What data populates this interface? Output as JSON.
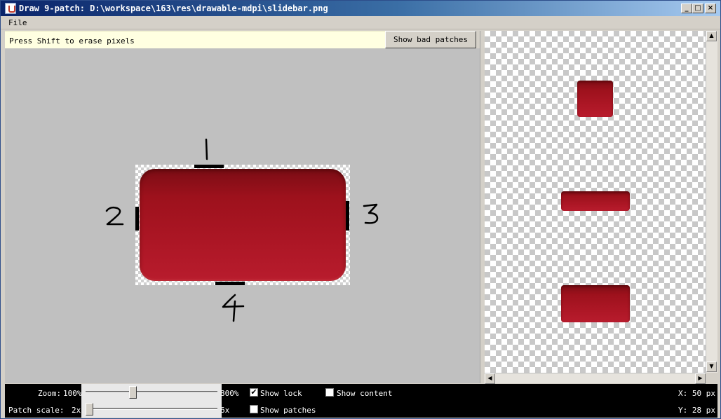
{
  "window": {
    "title": "Draw 9-patch: D:\\workspace\\163\\res\\drawable-mdpi\\slidebar.png",
    "buttons": {
      "minimize": "_",
      "maximize": "□",
      "close": "×"
    }
  },
  "menu": {
    "file": "File"
  },
  "editor": {
    "hint": "Press Shift to erase pixels",
    "show_bad_patches": "Show bad patches",
    "button_color": "#a5121f",
    "annotations": [
      "1",
      "2",
      "3",
      "4"
    ]
  },
  "controls": {
    "zoom_label": "Zoom:",
    "zoom_min": "100%",
    "zoom_max": "800%",
    "zoom_level": 0.35,
    "patch_scale_label": "Patch scale:",
    "patch_scale_min": "2x",
    "patch_scale_max": "6x",
    "patch_scale_level": 0,
    "show_lock": {
      "label": "Show lock",
      "checked": true
    },
    "show_content": {
      "label": "Show content",
      "checked": false
    },
    "show_patches": {
      "label": "Show patches",
      "checked": false
    },
    "x_readout": "X: 50 px",
    "y_readout": "Y: 28 px"
  },
  "icons": {
    "app": "java-cup-icon",
    "scroll_up": "▲",
    "scroll_down": "▼",
    "scroll_left": "◀",
    "scroll_right": "▶",
    "check_mark": "✔"
  }
}
